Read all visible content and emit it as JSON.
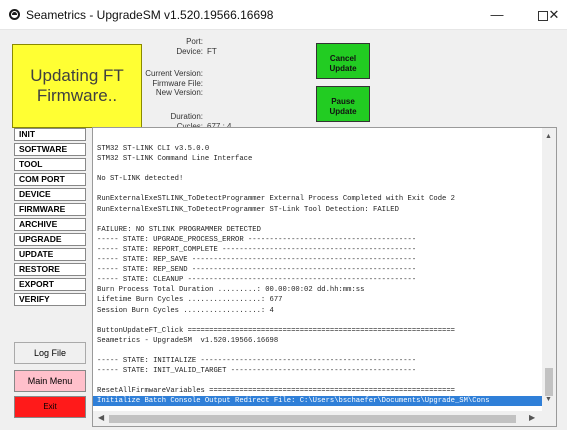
{
  "window": {
    "title": "Seametrics - UpgradeSM  v1.520.19566.16698",
    "min_label": "—",
    "close_label": "✕"
  },
  "status": {
    "line1": "Updating FT",
    "line2": "Firmware..",
    "color": "#ffff33"
  },
  "info": {
    "port_label": "Port:",
    "port_value": "",
    "device_label": "Device:",
    "device_value": "FT",
    "current_version_label": "Current Version:",
    "firmware_file_label": "Firmware File:",
    "new_version_label": "New Version:",
    "duration_label": "Duration:",
    "cycles_label": "Cycles:",
    "cycles_value": "677 : 4"
  },
  "buttons": {
    "cancel": "Cancel Update",
    "pause": "Pause Update",
    "log_file": "Log File",
    "main_menu": "Main Menu",
    "exit": "Exit",
    "green_color": "#22cc22",
    "main_menu_color": "#ffc0cb",
    "exit_color": "#ff1a1a"
  },
  "nav": {
    "items": [
      "INIT",
      "SOFTWARE",
      "TOOL",
      "COM PORT",
      "DEVICE",
      "FIRMWARE",
      "ARCHIVE",
      "UPGRADE",
      "UPDATE",
      "RESTORE",
      "EXPORT",
      "VERIFY"
    ]
  },
  "console": {
    "lines": [
      "STM32 ST-LINK CLI v3.5.0.0",
      "STM32 ST-LINK Command Line Interface",
      "",
      "No ST-LINK detected!",
      "",
      "RunExternalExeSTLINK_ToDetectProgrammer External Process Completed with Exit Code 2",
      "RunExternalExeSTLINK_ToDetectProgrammer ST-Link Tool Detection: FAILED",
      "",
      "FAILURE: NO STLINK PROGRAMMER DETECTED",
      "----- STATE: UPGRADE_PROCESS_ERROR ---------------------------------------",
      "----- STATE: REPORT_COMPLETE ---------------------------------------------",
      "----- STATE: REP_SAVE ----------------------------------------------------",
      "----- STATE: REP_SEND ----------------------------------------------------",
      "----- STATE: CLEANUP -----------------------------------------------------",
      "Burn Process Total Duration .........: 00.00:00:02 dd.hh:mm:ss",
      "Lifetime Burn Cycles .................: 677",
      "Session Burn Cycles ..................: 4",
      "",
      "ButtonUpdateFT_Click ==============================================================",
      "Seametrics - UpgradeSM  v1.520.19566.16698",
      "",
      "----- STATE: INITIALIZE --------------------------------------------------",
      "----- STATE: INIT_VALID_TARGET -------------------------------------------",
      "",
      "ResetAllFirmwareVariables =========================================================",
      "Initialize Batch Console Output Redirect File: C:\\Users\\bschaefer\\Documents\\Upgrade_SM\\Cons"
    ],
    "selected_index": 25
  }
}
